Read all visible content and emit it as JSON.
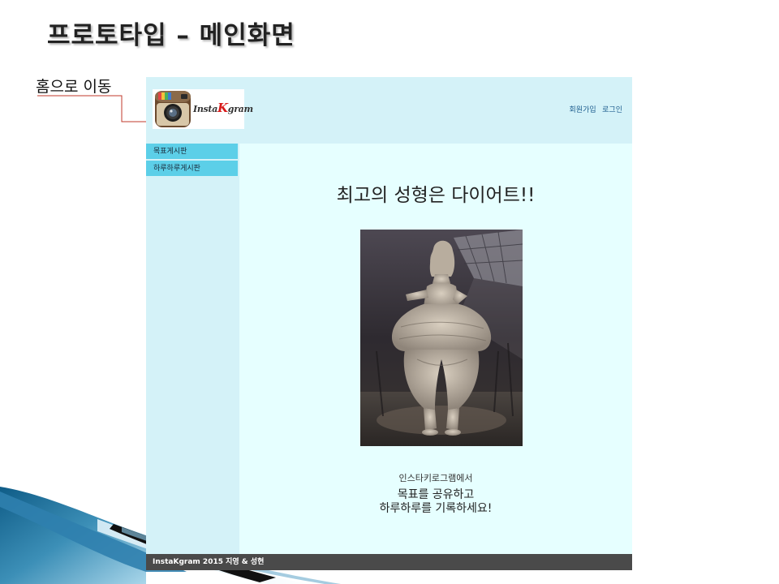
{
  "slide": {
    "title": "프로토타입 – 메인화면",
    "callout": "홈으로 이동"
  },
  "header": {
    "logo_text_before": "Insta",
    "logo_text_k": "K",
    "logo_text_after": "gram",
    "links": [
      "회원가입",
      "로그인"
    ]
  },
  "sidebar": {
    "items": [
      "목표게시판",
      "하루하루게시판"
    ]
  },
  "main": {
    "headline": "최고의 성형은 다이어트!!",
    "caption_small": "인스타키로그램에서",
    "caption_line1": "목표를 공유하고",
    "caption_line2": "하루하루를 기록하세요!"
  },
  "footer": {
    "text": "InstaKgram 2015 지영 & 성현"
  },
  "colors": {
    "header_bg": "#d4f2f8",
    "content_bg": "#e6ffff",
    "menu_item_bg": "#5ccfe8",
    "footer_bg": "#4a4a4a",
    "callout_line": "#c0392b",
    "link": "#1d5d8e"
  },
  "icons": [
    "instagram-camera-icon"
  ]
}
